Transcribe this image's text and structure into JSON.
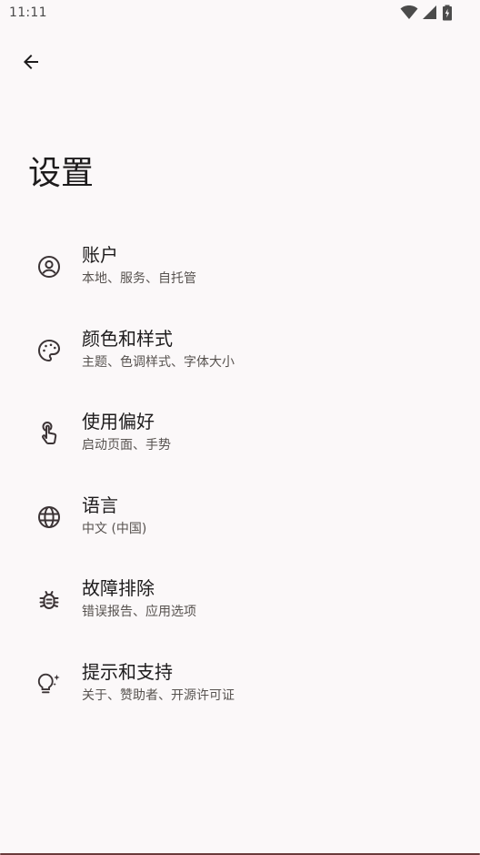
{
  "status_bar": {
    "time": "11:11",
    "icons": [
      "wifi-icon",
      "signal-icon",
      "battery-icon"
    ]
  },
  "header": {
    "back_icon": "arrow-back-icon",
    "title": "设置"
  },
  "settings": {
    "items": [
      {
        "icon": "account-circle-icon",
        "label": "账户",
        "summary": "本地、服务、自托管"
      },
      {
        "icon": "palette-icon",
        "label": "颜色和样式",
        "summary": "主题、色调样式、字体大小"
      },
      {
        "icon": "touch-app-icon",
        "label": "使用偏好",
        "summary": "启动页面、手势"
      },
      {
        "icon": "globe-icon",
        "label": "语言",
        "summary": "中文 (中国)"
      },
      {
        "icon": "bug-icon",
        "label": "故障排除",
        "summary": "错误报告、应用选项"
      },
      {
        "icon": "tips-icon",
        "label": "提示和支持",
        "summary": "关于、赞助者、开源许可证"
      }
    ]
  },
  "colors": {
    "background": "#fbf8f9",
    "text_primary": "#1d1b1c",
    "text_secondary": "#57524f",
    "icon": "#3c3436"
  }
}
